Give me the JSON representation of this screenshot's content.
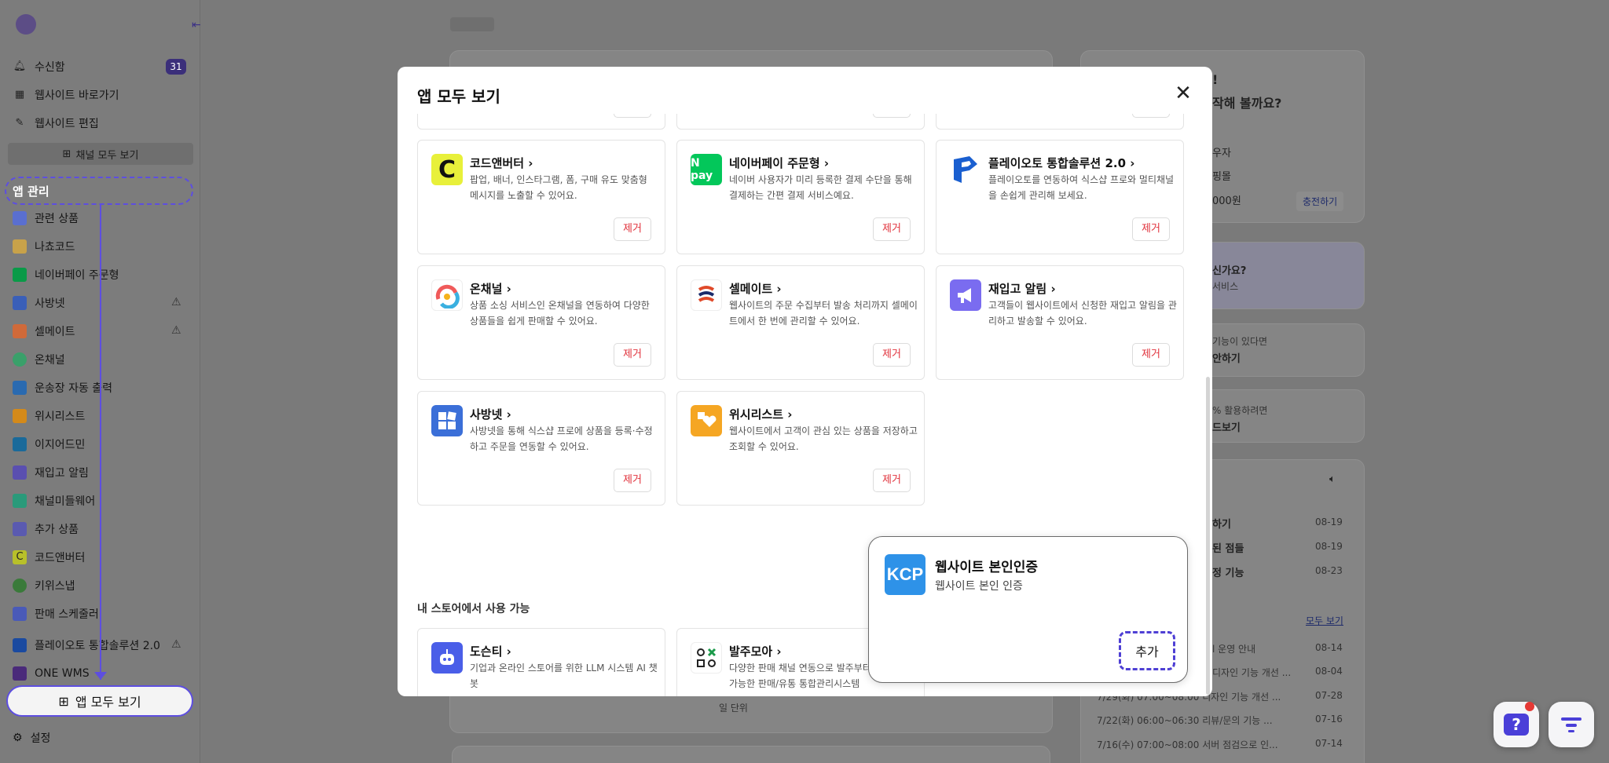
{
  "sidebar": {
    "inbox_label": "수신함",
    "inbox_count": "31",
    "goto_site_label": "웹사이트 바로가기",
    "edit_site_label": "웹사이트 편집",
    "channels_all_label": "채널 모두 보기",
    "app_manage_label": "앱 관리",
    "apps": [
      {
        "label": "관련 상품"
      },
      {
        "label": "나쵸코드"
      },
      {
        "label": "네이버페이 주문형"
      },
      {
        "label": "사방넷"
      },
      {
        "label": "셀메이트"
      },
      {
        "label": "온채널"
      },
      {
        "label": "운송장 자동 출력"
      },
      {
        "label": "위시리스트"
      },
      {
        "label": "이지어드민"
      },
      {
        "label": "재입고 알림"
      },
      {
        "label": "채널미들웨어"
      },
      {
        "label": "추가 상품"
      },
      {
        "label": "코드앤버터"
      },
      {
        "label": "키위스냅"
      },
      {
        "label": "판매 스케줄러"
      },
      {
        "label": "플레이오토 통합솔루션 2.0"
      },
      {
        "label": "ONE WMS"
      }
    ],
    "view_all_apps_label": "앱 모두 보기",
    "settings_label": "설정"
  },
  "background": {
    "headline_line1": "!",
    "headline_line2": "작해 볼까요?",
    "info_rows": [
      "우자",
      "핑몰",
      "000원"
    ],
    "charge_button": "충전하기",
    "promo_title": "신가요?",
    "promo_sub": "서비스",
    "suggest_sub": "기능이 있다면",
    "suggest_title": "안하기",
    "guide_sub": "% 활용하려면",
    "guide_title": "드보기",
    "news_items": [
      {
        "title": "하기",
        "date": "08-19"
      },
      {
        "title": "된 점들",
        "date": "08-19"
      },
      {
        "title": "정 기능",
        "date": "08-23"
      }
    ],
    "more_link": "모두 보기",
    "notices": [
      {
        "title": "l 운영 안내",
        "date": "08-14"
      },
      {
        "title": "디자인 기능 개선 ...",
        "date": "08-04"
      },
      {
        "title": "7/29(화) 07:00~08:00 디자인 기능 개선 ...",
        "date": "07-28"
      },
      {
        "title": "7/22(화) 06:00~06:30 리뷰/문의 기능 ...",
        "date": "07-16"
      },
      {
        "title": "7/16(수) 07:00~08:00 서버 점검으로 인...",
        "date": "07-14"
      }
    ],
    "unit_label": "일 단위"
  },
  "modal": {
    "title": "앱 모두 보기",
    "remove_label": "제거",
    "add_label": "추가",
    "installed": [
      {
        "name": "코드앤버터",
        "desc": "팝업, 배너, 인스타그램, 폼, 구매 유도 맞춤형 메시지를 노출할 수 있어요.",
        "icon": "codenbutter-icon",
        "color": "#e8f03a"
      },
      {
        "name": "네이버페이 주문형",
        "desc": "네이버 사용자가 미리 등록한 결제 수단을 통해 결제하는 간편 결제 서비스예요.",
        "icon": "naverpay-icon",
        "color": "#03c75a"
      },
      {
        "name": "플레이오토 통합솔루션 2.0",
        "desc": "플레이오토를 연동하여 식스샵 프로와 멀티채널을 손쉽게 관리해 보세요.",
        "icon": "playauto-icon",
        "color": "#1a5fd0"
      },
      {
        "name": "온채널",
        "desc": "상품 소싱 서비스인 온채널을 연동하여 다양한 상품들을 쉽게 판매할 수 있어요.",
        "icon": "onchannel-icon",
        "color": "#ffffff"
      },
      {
        "name": "셀메이트",
        "desc": "웹사이트의 주문 수집부터 발송 처리까지 셀메이트에서 한 번에 관리할 수 있어요.",
        "icon": "sellmate-icon",
        "color": "#ffffff"
      },
      {
        "name": "재입고 알림",
        "desc": "고객들이 웹사이트에서 신청한 재입고 알림을 관리하고 발송할 수 있어요.",
        "icon": "restock-icon",
        "color": "#7a6cf0"
      },
      {
        "name": "사방넷",
        "desc": "사방넷을 통해 식스샵 프로에 상품을 등록·수정하고 주문을 연동할 수 있어요.",
        "icon": "sabangnet-icon",
        "color": "#3b6fd8"
      },
      {
        "name": "위시리스트",
        "desc": "웹사이트에서 고객이 관심 있는 상품을 저장하고 조회할 수 있어요.",
        "icon": "wishlist-icon",
        "color": "#f5a623"
      }
    ],
    "available_section_label": "내 스토어에서 사용 가능",
    "available": [
      {
        "name": "도슨티",
        "desc": "기업과 온라인 스토어를 위한 LLM 시스템 AI 챗봇",
        "icon": "docenty-icon",
        "color": "#4a5ee8"
      },
      {
        "name": "발주모아",
        "desc": "다양한 판매 채널 연동으로 발주부터 정산까지 가능한 판매/유통 통합관리시스템",
        "icon": "baljumoa-icon",
        "color": "#ffffff"
      }
    ]
  },
  "popup": {
    "logo_text": "KCP",
    "title": "웹사이트 본인인증",
    "subtitle": "웹사이트 본인 인증",
    "add_label": "추가"
  }
}
